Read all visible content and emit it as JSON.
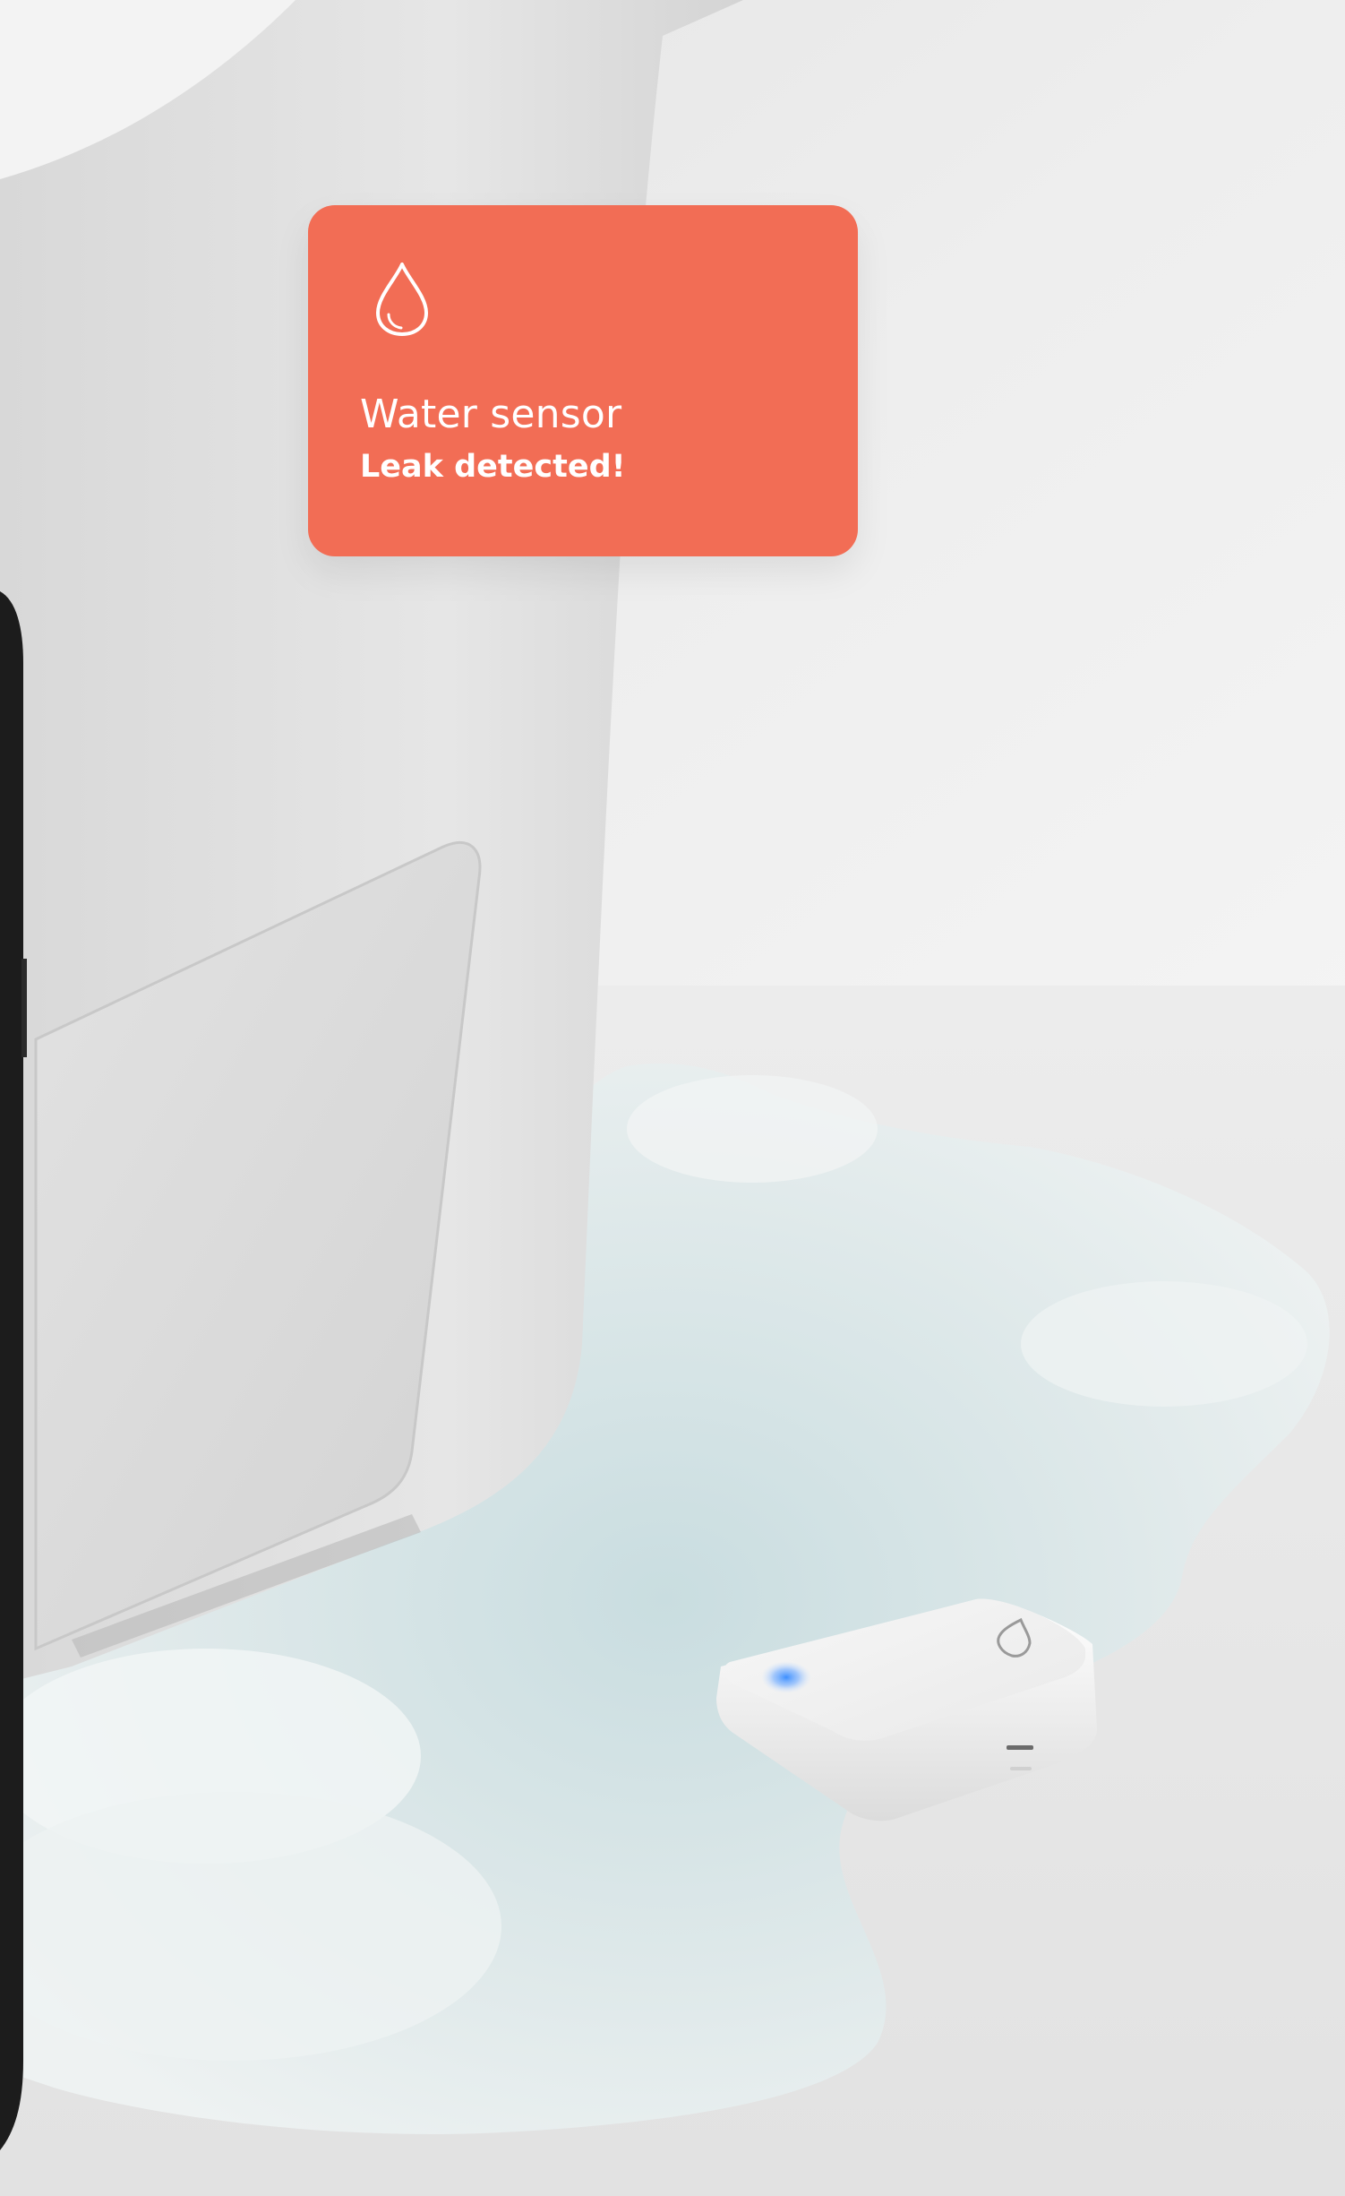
{
  "notification": {
    "icon": "water-drop-icon",
    "title": "Water sensor",
    "message": "Leak detected!",
    "background_color": "#f26d55",
    "text_color": "#ffffff"
  },
  "scene": {
    "sensor_icon": "water-drop-icon",
    "sensor_led_color": "#3d8fff"
  }
}
